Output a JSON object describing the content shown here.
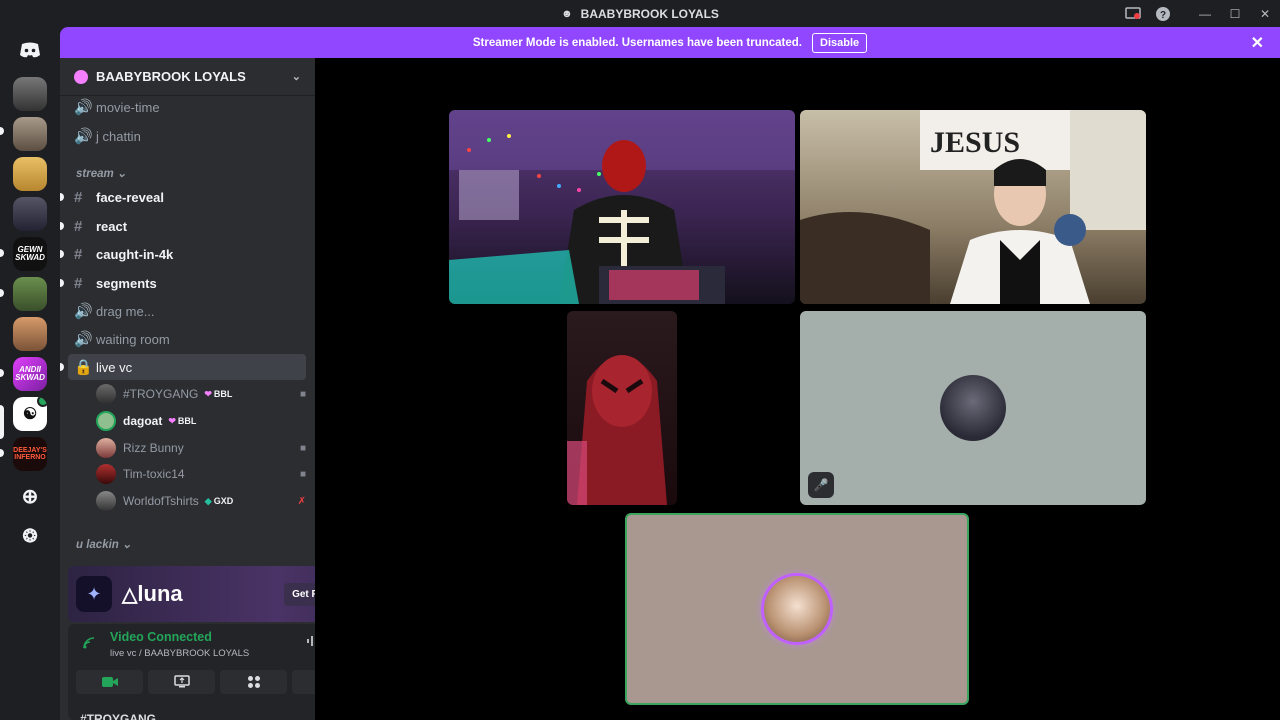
{
  "window": {
    "title": "BAABYBROOK LOYALS"
  },
  "banner": {
    "text": "Streamer Mode is enabled. Usernames have been truncated.",
    "button": "Disable"
  },
  "guild_labels": {
    "gewn": "GEWN SKWAD",
    "andii": "ANDII SKWAD",
    "deejay": "DEEJAY'S INFERNO"
  },
  "sidebar": {
    "server_name": "BAABYBROOK LOYALS",
    "channels_top": [
      {
        "name": "movie-time"
      },
      {
        "name": "j chattin"
      }
    ],
    "category_stream": "stream",
    "text_channels": [
      {
        "name": "face-reveal"
      },
      {
        "name": "react"
      },
      {
        "name": "caught-in-4k"
      },
      {
        "name": "segments"
      }
    ],
    "voice_channels": [
      {
        "name": "drag me..."
      },
      {
        "name": "waiting room"
      },
      {
        "name": "live vc"
      }
    ],
    "voice_users": [
      {
        "name": "#TROYGANG",
        "tag": "BBL"
      },
      {
        "name": "dagoat",
        "tag": "BBL"
      },
      {
        "name": "Rizz Bunny"
      },
      {
        "name": "Tim-toxic14"
      },
      {
        "name": "WorldofTshirts",
        "tag": "GXD"
      }
    ],
    "category_lackin": "u lackin"
  },
  "promo": {
    "brand": "luna",
    "button": "Get Reward!"
  },
  "voice_panel": {
    "status": "Video Connected",
    "location": "live vc / BAABYBROOK LOYALS"
  },
  "next_user_peek": "#TROYGANG",
  "colors": {
    "accent": "#9147ff",
    "connected": "#23a55a",
    "speaking": "#3ba55d"
  }
}
